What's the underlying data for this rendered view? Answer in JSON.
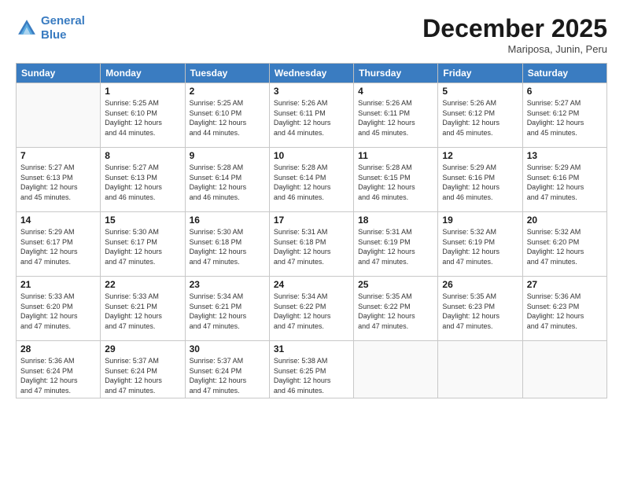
{
  "header": {
    "logo_line1": "General",
    "logo_line2": "Blue",
    "title": "December 2025",
    "subtitle": "Mariposa, Junin, Peru"
  },
  "weekdays": [
    "Sunday",
    "Monday",
    "Tuesday",
    "Wednesday",
    "Thursday",
    "Friday",
    "Saturday"
  ],
  "weeks": [
    [
      {
        "day": "",
        "info": ""
      },
      {
        "day": "1",
        "info": "Sunrise: 5:25 AM\nSunset: 6:10 PM\nDaylight: 12 hours\nand 44 minutes."
      },
      {
        "day": "2",
        "info": "Sunrise: 5:25 AM\nSunset: 6:10 PM\nDaylight: 12 hours\nand 44 minutes."
      },
      {
        "day": "3",
        "info": "Sunrise: 5:26 AM\nSunset: 6:11 PM\nDaylight: 12 hours\nand 44 minutes."
      },
      {
        "day": "4",
        "info": "Sunrise: 5:26 AM\nSunset: 6:11 PM\nDaylight: 12 hours\nand 45 minutes."
      },
      {
        "day": "5",
        "info": "Sunrise: 5:26 AM\nSunset: 6:12 PM\nDaylight: 12 hours\nand 45 minutes."
      },
      {
        "day": "6",
        "info": "Sunrise: 5:27 AM\nSunset: 6:12 PM\nDaylight: 12 hours\nand 45 minutes."
      }
    ],
    [
      {
        "day": "7",
        "info": "Sunrise: 5:27 AM\nSunset: 6:13 PM\nDaylight: 12 hours\nand 45 minutes."
      },
      {
        "day": "8",
        "info": "Sunrise: 5:27 AM\nSunset: 6:13 PM\nDaylight: 12 hours\nand 46 minutes."
      },
      {
        "day": "9",
        "info": "Sunrise: 5:28 AM\nSunset: 6:14 PM\nDaylight: 12 hours\nand 46 minutes."
      },
      {
        "day": "10",
        "info": "Sunrise: 5:28 AM\nSunset: 6:14 PM\nDaylight: 12 hours\nand 46 minutes."
      },
      {
        "day": "11",
        "info": "Sunrise: 5:28 AM\nSunset: 6:15 PM\nDaylight: 12 hours\nand 46 minutes."
      },
      {
        "day": "12",
        "info": "Sunrise: 5:29 AM\nSunset: 6:16 PM\nDaylight: 12 hours\nand 46 minutes."
      },
      {
        "day": "13",
        "info": "Sunrise: 5:29 AM\nSunset: 6:16 PM\nDaylight: 12 hours\nand 47 minutes."
      }
    ],
    [
      {
        "day": "14",
        "info": "Sunrise: 5:29 AM\nSunset: 6:17 PM\nDaylight: 12 hours\nand 47 minutes."
      },
      {
        "day": "15",
        "info": "Sunrise: 5:30 AM\nSunset: 6:17 PM\nDaylight: 12 hours\nand 47 minutes."
      },
      {
        "day": "16",
        "info": "Sunrise: 5:30 AM\nSunset: 6:18 PM\nDaylight: 12 hours\nand 47 minutes."
      },
      {
        "day": "17",
        "info": "Sunrise: 5:31 AM\nSunset: 6:18 PM\nDaylight: 12 hours\nand 47 minutes."
      },
      {
        "day": "18",
        "info": "Sunrise: 5:31 AM\nSunset: 6:19 PM\nDaylight: 12 hours\nand 47 minutes."
      },
      {
        "day": "19",
        "info": "Sunrise: 5:32 AM\nSunset: 6:19 PM\nDaylight: 12 hours\nand 47 minutes."
      },
      {
        "day": "20",
        "info": "Sunrise: 5:32 AM\nSunset: 6:20 PM\nDaylight: 12 hours\nand 47 minutes."
      }
    ],
    [
      {
        "day": "21",
        "info": "Sunrise: 5:33 AM\nSunset: 6:20 PM\nDaylight: 12 hours\nand 47 minutes."
      },
      {
        "day": "22",
        "info": "Sunrise: 5:33 AM\nSunset: 6:21 PM\nDaylight: 12 hours\nand 47 minutes."
      },
      {
        "day": "23",
        "info": "Sunrise: 5:34 AM\nSunset: 6:21 PM\nDaylight: 12 hours\nand 47 minutes."
      },
      {
        "day": "24",
        "info": "Sunrise: 5:34 AM\nSunset: 6:22 PM\nDaylight: 12 hours\nand 47 minutes."
      },
      {
        "day": "25",
        "info": "Sunrise: 5:35 AM\nSunset: 6:22 PM\nDaylight: 12 hours\nand 47 minutes."
      },
      {
        "day": "26",
        "info": "Sunrise: 5:35 AM\nSunset: 6:23 PM\nDaylight: 12 hours\nand 47 minutes."
      },
      {
        "day": "27",
        "info": "Sunrise: 5:36 AM\nSunset: 6:23 PM\nDaylight: 12 hours\nand 47 minutes."
      }
    ],
    [
      {
        "day": "28",
        "info": "Sunrise: 5:36 AM\nSunset: 6:24 PM\nDaylight: 12 hours\nand 47 minutes."
      },
      {
        "day": "29",
        "info": "Sunrise: 5:37 AM\nSunset: 6:24 PM\nDaylight: 12 hours\nand 47 minutes."
      },
      {
        "day": "30",
        "info": "Sunrise: 5:37 AM\nSunset: 6:24 PM\nDaylight: 12 hours\nand 47 minutes."
      },
      {
        "day": "31",
        "info": "Sunrise: 5:38 AM\nSunset: 6:25 PM\nDaylight: 12 hours\nand 46 minutes."
      },
      {
        "day": "",
        "info": ""
      },
      {
        "day": "",
        "info": ""
      },
      {
        "day": "",
        "info": ""
      }
    ]
  ]
}
